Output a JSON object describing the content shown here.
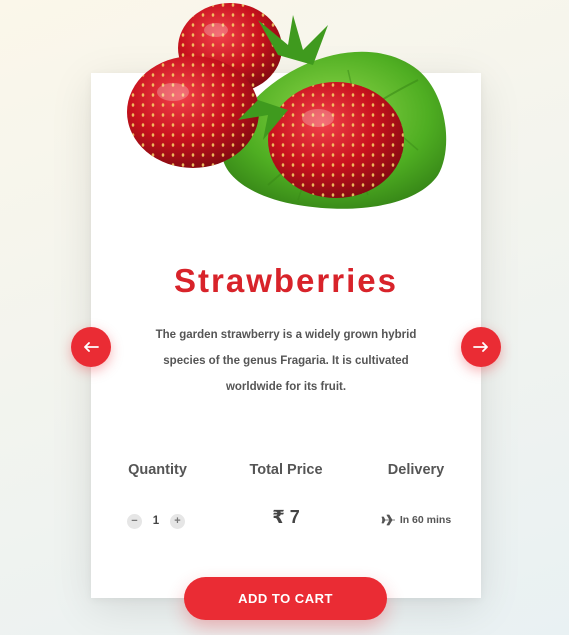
{
  "product": {
    "name": "Strawberries",
    "description": "The garden strawberry is a widely grown hybrid species of the genus Fragaria. It is cultivated worldwide for its fruit.",
    "image_icon": "strawberries-image"
  },
  "info": {
    "quantity_label": "Quantity",
    "total_price_label": "Total Price",
    "delivery_label": "Delivery",
    "quantity_value": "1",
    "decrement_symbol": "−",
    "increment_symbol": "+",
    "price_value": "₹ 7",
    "delivery_value": "In 60 mins",
    "delivery_icon": "airplane-icon"
  },
  "navigation": {
    "prev_icon": "arrow-left-icon",
    "next_icon": "arrow-right-icon"
  },
  "cart": {
    "button_label": "ADD TO CART"
  },
  "colors": {
    "accent": "#ea2c34",
    "title": "#d8232a",
    "text": "#555555",
    "leaf": "#4caf2a"
  }
}
